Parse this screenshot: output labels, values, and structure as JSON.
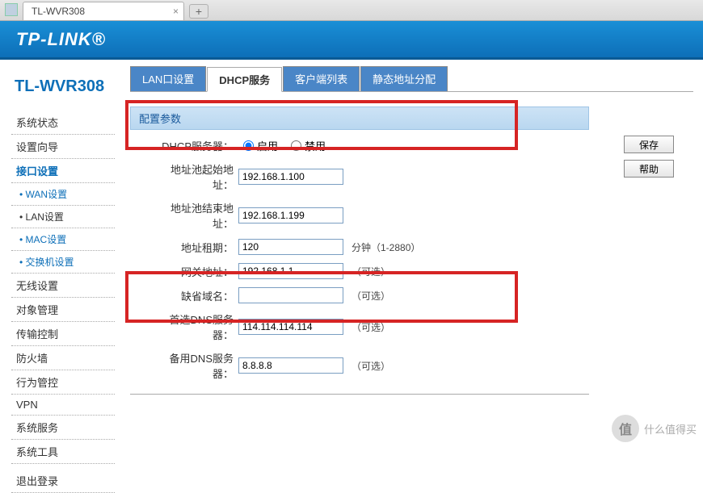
{
  "browser": {
    "tab_title": "TL-WVR308",
    "new_tab_label": "+",
    "close_label": "×"
  },
  "logo": "TP-LINK®",
  "model": "TL-WVR308",
  "sidebar": {
    "items": [
      {
        "label": "系统状态"
      },
      {
        "label": "设置向导"
      },
      {
        "label": "接口设置",
        "active": true
      },
      {
        "label": "• WAN设置",
        "sub": true
      },
      {
        "label": "• LAN设置",
        "sub": true,
        "current": true
      },
      {
        "label": "• MAC设置",
        "sub": true
      },
      {
        "label": "• 交换机设置",
        "sub": true
      },
      {
        "label": "无线设置"
      },
      {
        "label": "对象管理"
      },
      {
        "label": "传输控制"
      },
      {
        "label": "防火墙"
      },
      {
        "label": "行为管控"
      },
      {
        "label": "VPN"
      },
      {
        "label": "系统服务"
      },
      {
        "label": "系统工具"
      },
      {
        "label": "退出登录",
        "gap": true
      }
    ]
  },
  "tabs": [
    {
      "label": "LAN口设置"
    },
    {
      "label": "DHCP服务",
      "active": true
    },
    {
      "label": "客户端列表"
    },
    {
      "label": "静态地址分配"
    }
  ],
  "section_title": "配置参数",
  "form": {
    "dhcp_label": "DHCP服务器：",
    "enable": "启用",
    "disable": "禁用",
    "pool_start_label": "地址池起始地址：",
    "pool_start": "192.168.1.100",
    "pool_end_label": "地址池结束地址：",
    "pool_end": "192.168.1.199",
    "lease_label": "地址租期：",
    "lease": "120",
    "lease_hint": "分钟（1-2880）",
    "gateway_label": "网关地址：",
    "gateway": "192.168.1.1",
    "gateway_hint": "（可选）",
    "domain_label": "缺省域名：",
    "domain": "",
    "domain_hint": "（可选）",
    "dns1_label": "首选DNS服务器：",
    "dns1": "114.114.114.114",
    "dns1_hint": "（可选）",
    "dns2_label": "备用DNS服务器：",
    "dns2": "8.8.8.8",
    "dns2_hint": "（可选）"
  },
  "buttons": {
    "save": "保存",
    "help": "帮助"
  },
  "watermark": {
    "text": "什么值得买",
    "badge": "值"
  }
}
